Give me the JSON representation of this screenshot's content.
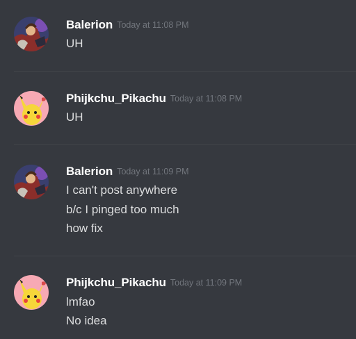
{
  "messages": [
    {
      "author": "Balerion",
      "avatar_icon": "balerion-avatar-icon",
      "timestamp": "Today at 11:08 PM",
      "lines": [
        "UH"
      ]
    },
    {
      "author": "Phijkchu_Pikachu",
      "avatar_icon": "pikachu-avatar-icon",
      "timestamp": "Today at 11:08 PM",
      "lines": [
        "UH"
      ]
    },
    {
      "author": "Balerion",
      "avatar_icon": "balerion-avatar-icon",
      "timestamp": "Today at 11:09 PM",
      "lines": [
        "I can't post anywhere",
        "b/c I pinged too much",
        "how fix"
      ]
    },
    {
      "author": "Phijkchu_Pikachu",
      "avatar_icon": "pikachu-avatar-icon",
      "timestamp": "Today at 11:09 PM",
      "lines": [
        "lmfao",
        "No idea"
      ]
    }
  ],
  "colors": {
    "background": "#36393f",
    "username": "#ffffff",
    "message_text": "#dcddde",
    "timestamp": "#72767d",
    "divider": "#42454a"
  }
}
